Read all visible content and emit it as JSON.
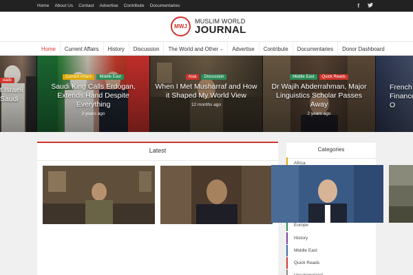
{
  "topbar": {
    "links": [
      "Home",
      "About Us",
      "Contact",
      "Advertise",
      "Contribute",
      "Documentaries"
    ],
    "social": [
      {
        "icon": "facebook-icon",
        "glyph": "f"
      },
      {
        "icon": "twitter-icon",
        "glyph": "t"
      }
    ]
  },
  "logo": {
    "mark": "MWJ",
    "line1": "MUSLIM WORLD",
    "line2": "JOURNAL"
  },
  "nav": {
    "items": [
      "Home",
      "Current Affairs",
      "History",
      "Discussion",
      "The World and Other",
      "Advertise",
      "Contribute",
      "Documentaries",
      "Donor Dashboard"
    ],
    "active": "Home"
  },
  "slides": [
    {
      "title": "t Israeli Saudi",
      "tags": [
        {
          "label": "eads",
          "color": "red"
        }
      ],
      "meta": ""
    },
    {
      "title": "Saudi King Calls Erdogan, Extends Hand Despite Everything",
      "tags": [
        {
          "label": "Current Affairs",
          "color": "yellow"
        },
        {
          "label": "Middle East",
          "color": "green"
        }
      ],
      "meta": "3 years ago"
    },
    {
      "title": "When I Met Musharraf and How it Shaped My World View",
      "tags": [
        {
          "label": "Asia",
          "color": "red"
        },
        {
          "label": "Discussion",
          "color": "green"
        }
      ],
      "meta": "12 months ago"
    },
    {
      "title": "Dr Wajih Abderrahman, Major Linguistics Scholar Passes Away",
      "tags": [
        {
          "label": "Middle East",
          "color": "green"
        },
        {
          "label": "Quick Reads",
          "color": "red"
        }
      ],
      "meta": "2 years ago"
    },
    {
      "title": "French Finance O",
      "tags": [],
      "meta": ""
    }
  ],
  "latest": {
    "title": "Latest"
  },
  "sidebar": {
    "title": "Categories",
    "categories": [
      "Africa",
      "Europe",
      "History",
      "Middle East",
      "Quick Reads",
      "Uncategorized"
    ]
  },
  "colors": {
    "accent": "#d0342c",
    "topbar": "#222222",
    "tag_green": "#2e8b57",
    "tag_yellow": "#e0a800"
  }
}
